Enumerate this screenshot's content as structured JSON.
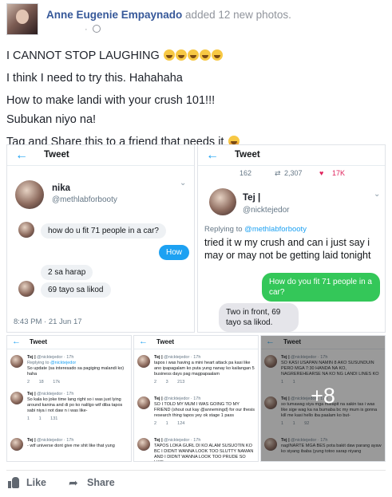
{
  "post": {
    "author": "Anne Eugenie Empaynado",
    "action": "added 12 new photos.",
    "meta_dot": "·",
    "lines": [
      "I CANNOT STOP LAUGHING",
      "I think I need to try this. Hahahaha",
      "How to make landi with your crush 101!!!",
      "Subukan niyo na!",
      "Tag and Share this to a friend that needs it"
    ]
  },
  "photo1": {
    "back": "←",
    "title": "Tweet",
    "name": "nika",
    "handle": "@methlabforbooty",
    "chevron": "⌄",
    "bubbles": [
      {
        "text": "how do u fit 71 people in a car?",
        "side": "in"
      },
      {
        "text": "How",
        "side": "out"
      },
      {
        "text": "2 sa harap",
        "side": "in"
      },
      {
        "text": "69 tayo sa likod",
        "side": "in"
      }
    ],
    "time": "8:43 PM · 21 Jun 17"
  },
  "photo2": {
    "back": "←",
    "title": "Tweet",
    "stats": {
      "replies": "162",
      "retweets": "2,307",
      "likes": "17K"
    },
    "name": "Tej |",
    "handle": "@nicktejedor",
    "chevron": "⌄",
    "replying_prefix": "Replying to",
    "replying_handle": "@methlabforbooty",
    "text": "tried it w my crush and can i just say i may or may not be getting laid tonight",
    "imsg_out": "How do you fit 71 people in a car?",
    "imsg_in": "Two in front, 69 tayo sa likod."
  },
  "photo3": {
    "back": "←",
    "title": "Tweet",
    "tweets": [
      {
        "name": "Tej |",
        "handle": "@nicktejedor · 17h",
        "reply_prefix": "Replying to",
        "reply_handle": "@nicktejedor",
        "text": "So update (sa interesado sa pagiging malandi ko) haha",
        "stats": "2 18 17k"
      },
      {
        "name": "Tej |",
        "handle": "@nicktejedor · 17h",
        "text": "So kala ko joke time lang right so i was just lying around kanina and di po ko nalilgo wtf diba tapos sabi niya i not daw n i was like-",
        "stats": "1 1 131"
      },
      {
        "name": "Tej |",
        "handle": "@nicktejedor · 17h",
        "text": "- wtf universe dont give me shit like that yung",
        "stats": ""
      }
    ]
  },
  "photo4": {
    "back": "←",
    "title": "Tweet",
    "tweets": [
      {
        "name": "Tej |",
        "handle": "@nicktejedor · 17h",
        "text": "tapos i was having a mini heart attack pa kasi like ano ipapagalam ko puta yung nanay ko kailangan 5 business days pag magpapaalam",
        "stats": "2 3 213"
      },
      {
        "name": "Tej |",
        "handle": "@nicktejedor · 17h",
        "text": "SO I TOLD MY MUM I WAS GOING TO MY FRIEND (shout out kay @annemingd) for our thesis research thing tapos yey ok stage 1 pass",
        "stats": "2 1 124"
      },
      {
        "name": "Tej |",
        "handle": "@nicktejedor · 17h",
        "text": "TAPOS LOKA GURL DI KO ALAM SUSUOTIN KO BC I DIDNT WANNA LOOK TOO SLUTTY NAMAN AND I DIDNT WANNA LOOK TOO PRUDE SO LIKE",
        "stats": ""
      }
    ]
  },
  "photo5": {
    "back": "←",
    "title": "Tweet",
    "overlay": "+8",
    "tweets": [
      {
        "name": "Tej |",
        "handle": "@nicktejedor · 17h",
        "text": "SO KASI USAPAN NAMIN 8 AKO SUSUNDUIN PERO MGA 7:30 HANDA NA KO, NAGREREHEARSE NA KO NG LANDI LINES KO",
        "stats": "1 1"
      },
      {
        "name": "Tej |",
        "handle": "@nicktejedor · 17h",
        "text": "so tumawag siya mga malapit na sakin tas i was like sige wag ka na bumaba bc my mum is gonna kill me kasi hello iba paalam ko but-",
        "stats": "1 1 92"
      },
      {
        "name": "Tej |",
        "handle": "@nicktejedor · 17h",
        "text": "nagINARTE MGA BES pota bakit daw parang ayaw ko siyang ibaba (yung totoo sarap niyang",
        "stats": ""
      }
    ]
  },
  "actions": {
    "like_label": "Like",
    "share_label": "Share",
    "share_icon": "➦"
  }
}
